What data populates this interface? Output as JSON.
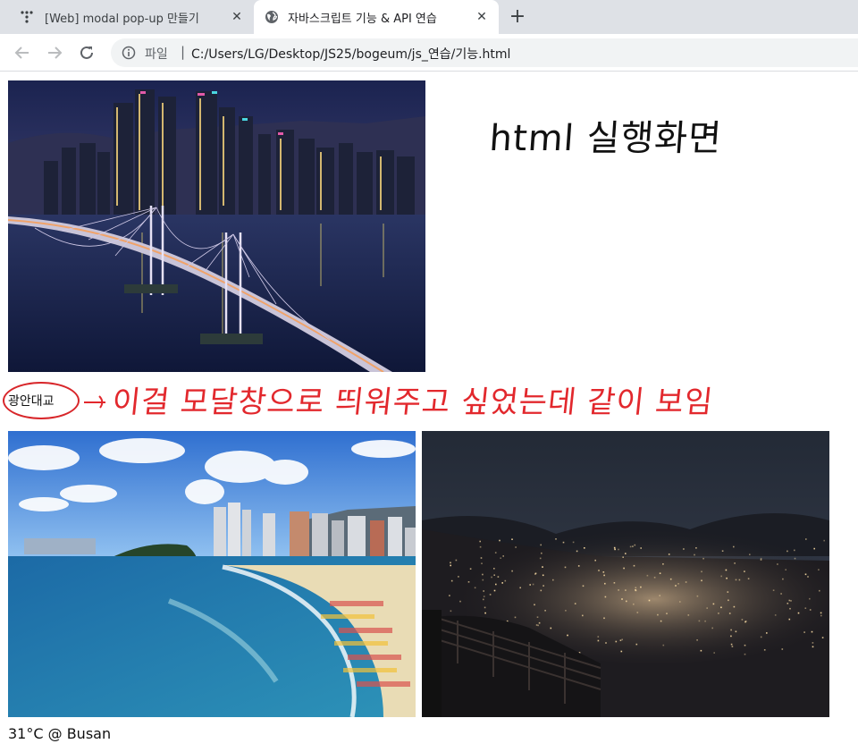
{
  "browser": {
    "tabs": [
      {
        "title": "[Web] modal pop-up 만들기",
        "active": false,
        "icon": "app-dots-icon"
      },
      {
        "title": "자바스크립트 기능 & API 연습",
        "active": true,
        "icon": "globe-icon"
      }
    ],
    "new_tab_symbol": "+",
    "close_symbol": "✕",
    "address": {
      "scheme_label": "파일",
      "separator": "|",
      "url": "C:/Users/LG/Desktop/JS25/bogeum/js_연습/기능.html"
    }
  },
  "page": {
    "images": [
      {
        "name": "gwangan-bridge-night",
        "subject": "Gwangan Bridge at night"
      },
      {
        "name": "haeundae-beach",
        "subject": "Haeundae beach in daytime"
      },
      {
        "name": "busan-night-view",
        "subject": "Busan city night view from a mountain"
      }
    ],
    "caption": "광안대교",
    "weather": "31°C @ Busan"
  },
  "annotations": {
    "title": "html 실행화면",
    "note": "이걸 모달창으로 띄워주고 싶었는데 같이 보임",
    "arrow": "→",
    "colors": {
      "red": "#e2282d",
      "black": "#111111"
    }
  }
}
